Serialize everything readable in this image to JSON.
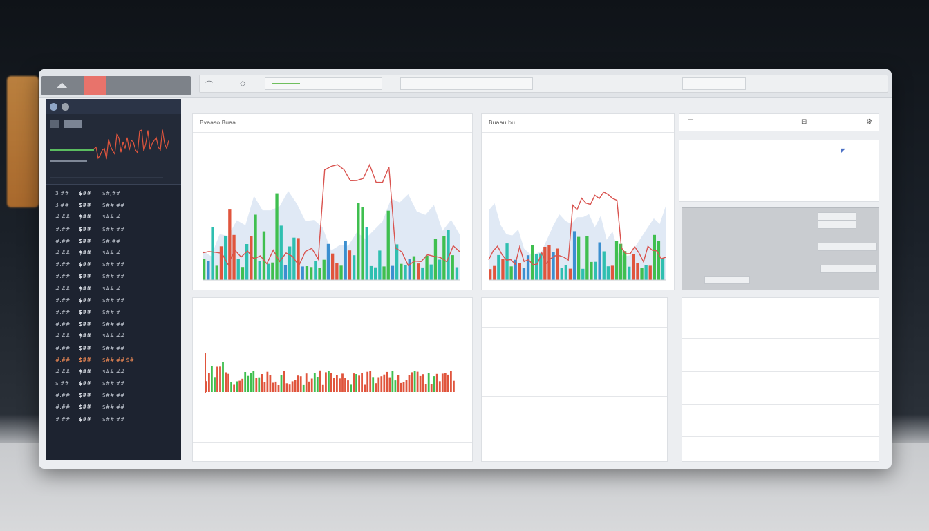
{
  "colors": {
    "accent_red": "#d9534f",
    "accent_green": "#3fbf4f",
    "accent_blue": "#3c8fd0",
    "accent_orange": "#e58b2b",
    "sidebar_bg": "#1d2330"
  },
  "icons": [
    "logo-icon",
    "arrow-icon",
    "diamond-icon",
    "menu-icon",
    "gear-icon",
    "close-icon"
  ],
  "sidebar": {
    "rows": [
      {
        "c1": "3 ##",
        "c2": "$##",
        "c3": "$#,##"
      },
      {
        "c1": "3 ##",
        "c2": "$##",
        "c3": "$##.##"
      },
      {
        "c1": "#.##",
        "c2": "$##",
        "c3": "$##,#"
      },
      {
        "c1": "#.##",
        "c2": "$##",
        "c3": "$##,##"
      },
      {
        "c1": "#.##",
        "c2": "$##",
        "c3": "$#,##"
      },
      {
        "c1": "#.##",
        "c2": "$##",
        "c3": "$##.#"
      },
      {
        "c1": "#.##",
        "c2": "$##",
        "c3": "$##,##"
      },
      {
        "c1": "#.##",
        "c2": "$##",
        "c3": "$##.##"
      },
      {
        "c1": "#.##",
        "c2": "$##",
        "c3": "$##.#"
      },
      {
        "c1": "#.##",
        "c2": "$##",
        "c3": "$##.##"
      },
      {
        "c1": "#.##",
        "c2": "$##",
        "c3": "$##.#"
      },
      {
        "c1": "#.##",
        "c2": "$##",
        "c3": "$##,##"
      },
      {
        "c1": "#.##",
        "c2": "$##",
        "c3": "$##.##"
      },
      {
        "c1": "#.##",
        "c2": "$##",
        "c3": "$##.##"
      },
      {
        "c1": "#.##",
        "c2": "$##",
        "c3": "$##.## $#",
        "hl": true
      },
      {
        "c1": "#.##",
        "c2": "$##",
        "c3": "$##.##"
      },
      {
        "c1": "$ ##",
        "c2": "$##",
        "c3": "$##,##"
      },
      {
        "c1": "#.##",
        "c2": "$##",
        "c3": "$##.##"
      },
      {
        "c1": "#.##",
        "c2": "$##",
        "c3": "$##,##"
      },
      {
        "c1": "# ##",
        "c2": "$##",
        "c3": "$##.##"
      }
    ]
  },
  "panels": {
    "p1": {
      "title": "Bvaaso Buaa"
    },
    "p2": {
      "title": "Buaau bu"
    },
    "p3": {},
    "p4": {},
    "p5": {},
    "p6": {},
    "p7": {}
  }
}
